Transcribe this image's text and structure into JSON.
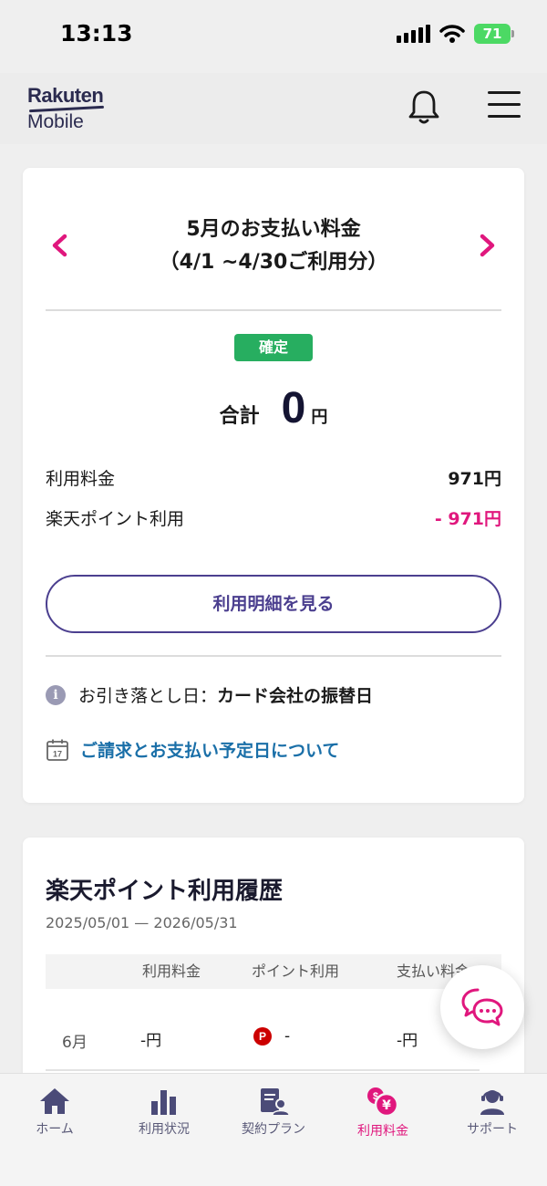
{
  "status_bar": {
    "time": "13:13",
    "battery": "71"
  },
  "header": {
    "logo_top": "Rakuten",
    "logo_bottom": "Mobile"
  },
  "billing": {
    "title_line1": "5月のお支払い料金",
    "title_line2": "（4/1 ~4/30ご利用分）",
    "status": "確定",
    "total_label": "合計",
    "total_amount": "0",
    "total_unit": "円",
    "lines": [
      {
        "label": "利用料金",
        "value": "971円"
      },
      {
        "label": "楽天ポイント利用",
        "value": "- 971円"
      }
    ],
    "detail_button": "利用明細を見る",
    "withdraw_label": "お引き落とし日：",
    "withdraw_value": "カード会社の振替日",
    "schedule_link": "ご請求とお支払い予定日について"
  },
  "history": {
    "title": "楽天ポイント利用履歴",
    "range": "2025/05/01 — 2026/05/31",
    "columns": [
      "利用料金",
      "ポイント利用",
      "支払い料金"
    ],
    "rows": [
      {
        "month": "6月",
        "fee": "-円",
        "point_badge": "P",
        "points": "-",
        "paid": "-円"
      }
    ]
  },
  "bottom_nav": [
    {
      "label": "ホーム"
    },
    {
      "label": "利用状況"
    },
    {
      "label": "契約プラン"
    },
    {
      "label": "利用料金",
      "active": true
    },
    {
      "label": "サポート"
    }
  ],
  "colors": {
    "accent": "#e0177d",
    "primary": "#4b3f8f",
    "confirmed": "#27ae60",
    "link": "#1a6fa8"
  }
}
